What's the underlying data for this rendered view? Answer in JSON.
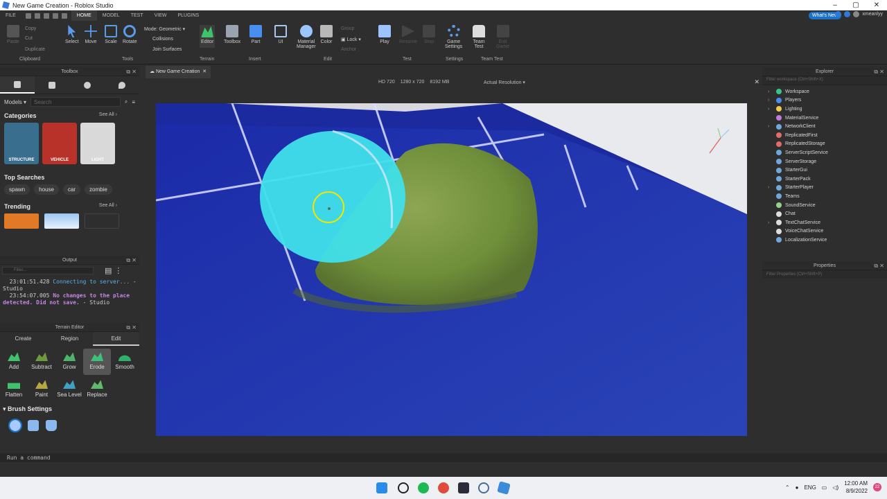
{
  "window": {
    "title": "New Game Creation - Roblox Studio",
    "controls": [
      "–",
      "▢",
      "✕"
    ]
  },
  "menu": {
    "items": [
      "FILE",
      "HOME",
      "MODEL",
      "TEST",
      "VIEW",
      "PLUGINS"
    ],
    "active": "HOME"
  },
  "top_right": {
    "whats_new": "What's New",
    "username": "xmeanlyy"
  },
  "ribbon": {
    "clipboard": {
      "paste": "Paste",
      "copy": "Copy",
      "cut": "Cut",
      "duplicate": "Duplicate",
      "group_label": "Clipboard"
    },
    "tools": {
      "select": "Select",
      "move": "Move",
      "scale": "Scale",
      "rotate": "Rotate",
      "mode_label": "Mode:",
      "mode_value": "Geometric",
      "collisions": "Collisions",
      "join_surfaces": "Join Surfaces",
      "group_label": "Tools"
    },
    "terrain": {
      "editor": "Editor",
      "group_label": "Terrain"
    },
    "insert": {
      "toolbox": "Toolbox",
      "part": "Part",
      "ui": "UI",
      "group_label": "Insert"
    },
    "edit": {
      "material_manager": "Material\nManager",
      "color": "Color",
      "group": "Group",
      "lock": "Lock",
      "anchor": "Anchor",
      "group_label": "Edit"
    },
    "test": {
      "play": "Play",
      "resume": "Resume",
      "stop": "Stop",
      "group_label": "Test"
    },
    "settings": {
      "game_settings": "Game\nSettings",
      "group_label": "Settings"
    },
    "team_test": {
      "team_test": "Team\nTest",
      "exit_game": "Exit\nGame",
      "group_label": "Team Test"
    }
  },
  "toolbox": {
    "title": "Toolbox",
    "category_dropdown": "Models",
    "search_placeholder": "Search",
    "categories_title": "Categories",
    "see_all": "See All ›",
    "categories": [
      {
        "label": "STRUCTURE",
        "color": "#3a6e8f"
      },
      {
        "label": "VEHICLE",
        "color": "#b8322a"
      },
      {
        "label": "LIGHT",
        "color": "#d9d9d9"
      }
    ],
    "top_searches_title": "Top Searches",
    "top_searches": [
      "spawn",
      "house",
      "car",
      "zombie"
    ],
    "trending_title": "Trending",
    "trending_see_all": "See All ›"
  },
  "output": {
    "title": "Output",
    "filter_placeholder": "Filter...",
    "logs": [
      {
        "time": "23:01:51.428",
        "msg": "Connecting to server...",
        "suffix": "- Studio",
        "color": "#5fb0e8"
      },
      {
        "time": "23:54:07.005",
        "msg": "No changes to the place detected. Did not save.",
        "suffix": "- Studio",
        "color": "#c785e8"
      }
    ]
  },
  "terrain_editor": {
    "title": "Terrain Editor",
    "tabs": [
      "Create",
      "Region",
      "Edit"
    ],
    "active_tab": "Edit",
    "tools": [
      {
        "label": "Add",
        "color": "#3ec36a"
      },
      {
        "label": "Subtract",
        "color": "#6c9a3e"
      },
      {
        "label": "Grow",
        "color": "#4db56a"
      },
      {
        "label": "Erode",
        "color": "#3fbf77"
      },
      {
        "label": "Smooth",
        "color": "#2fb06b"
      },
      {
        "label": "Flatten",
        "color": "#3ec36a"
      },
      {
        "label": "Paint",
        "color": "#b6a83e"
      },
      {
        "label": "Sea Level",
        "color": "#3ea3c3"
      },
      {
        "label": "Replace",
        "color": "#5dbb6a"
      }
    ],
    "selected_tool": "Erode",
    "brush_settings": "Brush Settings"
  },
  "viewport": {
    "tab": "New Game Creation",
    "device": "HD 720",
    "resolution": "1280 x 720",
    "memory": "8192 MB",
    "scale": "Actual Resolution"
  },
  "explorer": {
    "title": "Explorer",
    "filter_placeholder": "Filter workspace (Ctrl+Shift+X)",
    "items": [
      {
        "label": "Workspace",
        "expandable": true,
        "color": "#37c48a"
      },
      {
        "label": "Players",
        "expandable": true,
        "color": "#4a8ff0"
      },
      {
        "label": "Lighting",
        "expandable": true,
        "color": "#f2c94c"
      },
      {
        "label": "MaterialService",
        "expandable": false,
        "color": "#c17bd8"
      },
      {
        "label": "NetworkClient",
        "expandable": true,
        "color": "#6fa8dc"
      },
      {
        "label": "ReplicatedFirst",
        "expandable": false,
        "color": "#e36b6b"
      },
      {
        "label": "ReplicatedStorage",
        "expandable": false,
        "color": "#e36b6b"
      },
      {
        "label": "ServerScriptService",
        "expandable": false,
        "color": "#6fa8dc"
      },
      {
        "label": "ServerStorage",
        "expandable": false,
        "color": "#6fa8dc"
      },
      {
        "label": "StarterGui",
        "expandable": false,
        "color": "#6fa8dc"
      },
      {
        "label": "StarterPack",
        "expandable": false,
        "color": "#6fa8dc"
      },
      {
        "label": "StarterPlayer",
        "expandable": true,
        "color": "#6fa8dc"
      },
      {
        "label": "Teams",
        "expandable": false,
        "color": "#6fa8dc"
      },
      {
        "label": "SoundService",
        "expandable": false,
        "color": "#9ad08f"
      },
      {
        "label": "Chat",
        "expandable": false,
        "color": "#ddd"
      },
      {
        "label": "TextChatService",
        "expandable": true,
        "color": "#ddd"
      },
      {
        "label": "VoiceChatService",
        "expandable": false,
        "color": "#ddd"
      },
      {
        "label": "LocalizationService",
        "expandable": false,
        "color": "#6fa8dc"
      }
    ]
  },
  "properties": {
    "title": "Properties",
    "filter_placeholder": "Filter Properties (Ctrl+Shift+P)"
  },
  "command_bar": {
    "placeholder": "Run a command"
  },
  "taskbar": {
    "lang": "ENG",
    "time": "12:00 AM",
    "date": "8/9/2022",
    "notifications": "22"
  }
}
